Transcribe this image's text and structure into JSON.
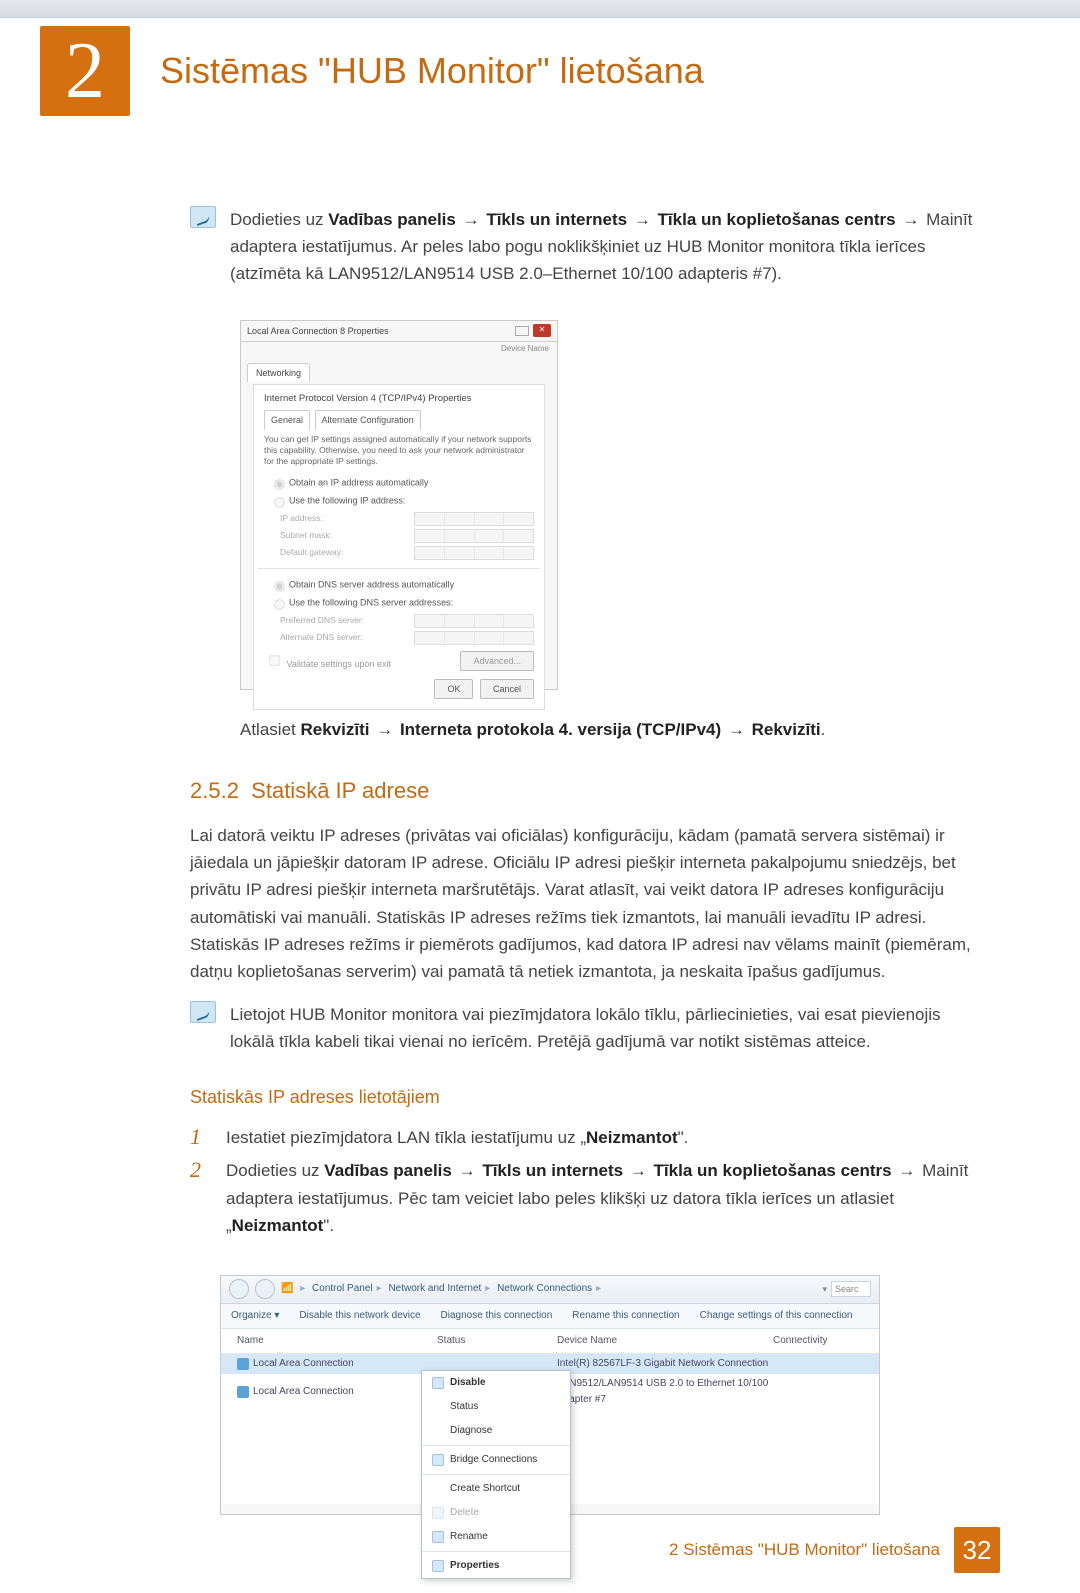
{
  "chapter": {
    "number": "2",
    "title": "Sistēmas \"HUB Monitor\" lietošana"
  },
  "intro_note": {
    "prefix": "Dodieties uz",
    "path1": "Vadības panelis",
    "path2": "Tīkls un internets",
    "path3": "Tīkla un koplietošanas centrs",
    "tail": "Mainīt adaptera iestatījumus. Ar peles labo pogu noklikšķiniet uz HUB Monitor monitora tīkla ierīces (atzīmēta kā LAN9512/LAN9514 USB 2.0–Ethernet 10/100 adapteris #7)."
  },
  "fig1": {
    "window_title": "Local Area Connection 8 Properties",
    "top_right": "Device Name",
    "tab": "Networking",
    "inner_title": "Internet Protocol Version 4 (TCP/IPv4) Properties",
    "subtab1": "General",
    "subtab2": "Alternate Configuration",
    "desc": "You can get IP settings assigned automatically if your network supports this capability. Otherwise, you need to ask your network administrator for the appropriate IP settings.",
    "r1": "Obtain an IP address automatically",
    "r2": "Use the following IP address:",
    "f_ip": "IP address:",
    "f_mask": "Subnet mask:",
    "f_gw": "Default gateway:",
    "r3": "Obtain DNS server address automatically",
    "r4": "Use the following DNS server addresses:",
    "f_dns1": "Preferred DNS server:",
    "f_dns2": "Alternate DNS server:",
    "chk": "Validate settings upon exit",
    "adv": "Advanced...",
    "ok": "OK",
    "cancel": "Cancel"
  },
  "caption1": {
    "prefix": "Atlasiet",
    "p1": "Rekvizīti",
    "p2": "Interneta protokola 4. versija (TCP/IPv4)",
    "p3": "Rekvizīti"
  },
  "section": {
    "num": "2.5.2",
    "title": "Statiskā IP adrese"
  },
  "body1": "Lai datorā veiktu IP adreses (privātas vai oficiālas) konfigurāciju, kādam (pamatā servera sistēmai) ir jāiedala un jāpiešķir datoram IP adrese. Oficiālu IP adresi piešķir interneta pakalpojumu sniedzējs, bet privātu IP adresi piešķir interneta maršrutētājs. Varat atlasīt, vai veikt datora IP adreses konfigurāciju automātiski vai manuāli. Statiskās IP adreses režīms tiek izmantots, lai manuāli ievadītu IP adresi. Statiskās IP adreses režīms ir piemērots gadījumos, kad datora IP adresi nav vēlams mainīt (piemēram, datņu koplietošanas serverim) vai pamatā tā netiek izmantota, ja neskaita īpašus gadījumus.",
  "note2": "Lietojot HUB Monitor monitora vai piezīmjdatora lokālo tīklu, pārliecinieties, vai esat pievienojis lokālā tīkla kabeli tikai vienai no ierīcēm. Pretējā gadījumā var notikt sistēmas atteice.",
  "subsection": "Statiskās IP adreses lietotājiem",
  "step1": {
    "prefix": "Iestatiet piezīmjdatora LAN tīkla iestatījumu uz „",
    "bold": "Neizmantot",
    "suffix": "\"."
  },
  "step2": {
    "prefix": "Dodieties uz",
    "p1": "Vadības panelis",
    "p2": "Tīkls un internets",
    "p3": "Tīkla un koplietošanas centrs",
    "tail1": "Mainīt adaptera iestatījumus. Pēc tam veiciet labo peles klikšķi uz datora tīkla ierīces un atlasiet „",
    "bold": "Neizmantot",
    "tail2": "\"."
  },
  "fig2": {
    "bc1": "Control Panel",
    "bc2": "Network and Internet",
    "bc3": "Network Connections",
    "search": "Searc",
    "tb_organize": "Organize ▾",
    "tb_disable": "Disable this network device",
    "tb_diagnose": "Diagnose this connection",
    "tb_rename": "Rename this connection",
    "tb_change": "Change settings of this connection",
    "th_name": "Name",
    "th_status": "Status",
    "th_device": "Device Name",
    "th_conn": "Connectivity",
    "row1_name": "Local Area Connection",
    "row1_dev": "Intel(R) 82567LF-3 Gigabit Network Connection",
    "row2_name": "Local Area Connection",
    "row2_dev": "LAN9512/LAN9514 USB 2.0 to Ethernet 10/100 Adapter #7",
    "cm": {
      "disable": "Disable",
      "status": "Status",
      "diagnose": "Diagnose",
      "bridge": "Bridge Connections",
      "shortcut": "Create Shortcut",
      "delete": "Delete",
      "rename": "Rename",
      "properties": "Properties"
    }
  },
  "footer": {
    "text": "2 Sistēmas \"HUB Monitor\" lietošana",
    "page": "32"
  },
  "fig2_search_icon": "🔍"
}
